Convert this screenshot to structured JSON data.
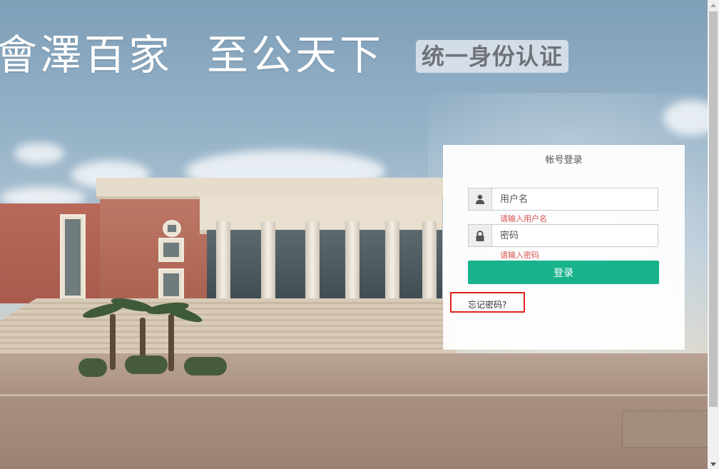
{
  "banner": {
    "title_part1": "會澤百家",
    "title_part2": "至公天下",
    "badge": "统一身份认证"
  },
  "login": {
    "title": "帐号登录",
    "username": {
      "placeholder": "用户名",
      "value": "",
      "icon": "user-icon",
      "hint": "请输入用户名"
    },
    "password": {
      "placeholder": "密码",
      "value": "",
      "icon": "lock-icon",
      "hint": "请输入密码"
    },
    "submit_label": "登录",
    "forgot_label": "忘记密码?"
  },
  "colors": {
    "accent": "#18b38d",
    "error": "#d9534f",
    "highlight": "#e0231d"
  }
}
